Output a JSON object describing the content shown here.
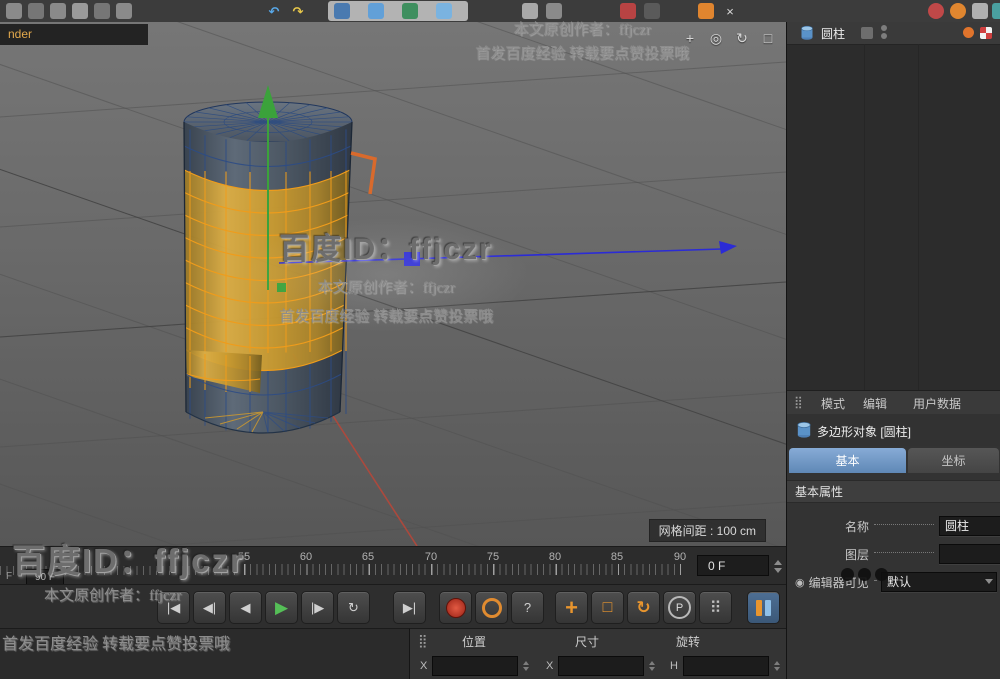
{
  "window": {
    "title_fragment": "nder"
  },
  "watermark": {
    "id": "百度ID：ffjczr",
    "author": "本文原创作者：ffjczr",
    "slogan": "首发百度经验 转载要点赞投票哦"
  },
  "viewport": {
    "grid_spacing_label": "网格间距 : 100 cm"
  },
  "object_manager": {
    "object_name": "圆柱"
  },
  "attribute_manager": {
    "tabs": [
      "模式",
      "编辑",
      "用户数据"
    ],
    "object_title": "多边形对象 [圆柱]",
    "sub_tabs": [
      "基本",
      "坐标"
    ],
    "section_title": "基本属性",
    "fields": [
      {
        "label": "名称",
        "value": "圆柱"
      },
      {
        "label": "图层",
        "value": ""
      },
      {
        "label": "编辑器可见",
        "value": "默认"
      }
    ]
  },
  "timeline": {
    "ticks": [
      "55",
      "60",
      "65",
      "70",
      "75",
      "80",
      "85",
      "90"
    ],
    "current_frame": "0 F",
    "range_start": "F",
    "range_end": "90 F"
  },
  "transport": {
    "to_start": "|◀",
    "prev_key": "◀|",
    "prev_frame": "◀",
    "play": "▶",
    "next_frame": "|▶",
    "loop": "↻",
    "to_end": "▶|",
    "help": "?",
    "move": "+",
    "scale": "□",
    "rotate": "↻",
    "p": "P",
    "dots": "⠿"
  },
  "coords": {
    "headers": [
      "位置",
      "尺寸",
      "旋转"
    ],
    "row_labels": [
      "X",
      "X",
      "H"
    ],
    "values": [
      "",
      "",
      ""
    ]
  },
  "icons": {
    "undo": "↶",
    "redo": "↷",
    "close": "×",
    "pan": "+",
    "zoom": "◎",
    "rotate": "↻",
    "maximize": "□",
    "grid": "⣿"
  },
  "colors": {
    "selection": "#d6a33e",
    "axis_x": "#b5473a",
    "axis_y": "#3ba23b",
    "axis_z": "#2b2bd6",
    "tab_active": "#6f95c2"
  }
}
